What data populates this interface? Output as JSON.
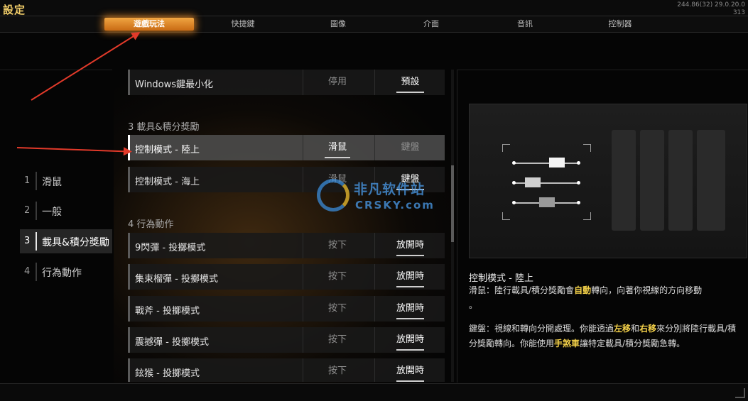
{
  "window": {
    "title": "設定",
    "version_line1": "244.86(32) 29.0.20.0",
    "version_line2": "313"
  },
  "tabs": [
    {
      "label": "遊戲玩法",
      "active": true
    },
    {
      "label": "快捷鍵",
      "active": false
    },
    {
      "label": "圖像",
      "active": false
    },
    {
      "label": "介面",
      "active": false
    },
    {
      "label": "音訊",
      "active": false
    },
    {
      "label": "控制器",
      "active": false
    }
  ],
  "categories": [
    {
      "num": "1",
      "label": "滑鼠",
      "active": false
    },
    {
      "num": "2",
      "label": "一般",
      "active": false
    },
    {
      "num": "3",
      "label": "載具&積分獎勵",
      "active": true
    },
    {
      "num": "4",
      "label": "行為動作",
      "active": false
    }
  ],
  "settings": {
    "top_row": {
      "name": "Windows鍵最小化",
      "opt1": "停用",
      "opt2": "預設",
      "selected": "opt2"
    },
    "section3": "3 載具&積分獎勵",
    "vehicle_rows": [
      {
        "name": "控制模式 - 陸上",
        "opt1": "滑鼠",
        "opt2": "鍵盤",
        "selected": "opt1",
        "highlighted": true
      },
      {
        "name": "控制模式 - 海上",
        "opt1": "滑鼠",
        "opt2": "鍵盤",
        "selected": "opt2",
        "highlighted": false
      }
    ],
    "section4": "4 行為動作",
    "action_rows": [
      {
        "name": "9閃彈 - 投擲模式",
        "opt1": "按下",
        "opt2": "放開時",
        "selected": "opt2"
      },
      {
        "name": "集束榴彈 - 投擲模式",
        "opt1": "按下",
        "opt2": "放開時",
        "selected": "opt2"
      },
      {
        "name": "戰斧 - 投擲模式",
        "opt1": "按下",
        "opt2": "放開時",
        "selected": "opt2"
      },
      {
        "name": "震撼彈 - 投擲模式",
        "opt1": "按下",
        "opt2": "放開時",
        "selected": "opt2"
      },
      {
        "name": "鉉猴 - 投擲模式",
        "opt1": "按下",
        "opt2": "放開時",
        "selected": "opt2"
      }
    ]
  },
  "watermark": {
    "line1": "非凡软件站",
    "line2": "CRSKY.com"
  },
  "description": {
    "title": "控制模式 - 陸上",
    "mouse_label": "滑鼠：",
    "mouse_text_a": "陸行載具/積分獎勵會",
    "mouse_hl": "自動",
    "mouse_text_b": "轉向，向著你視線的方向移動",
    "mouse_end": "。",
    "kb_label": "鍵盤：",
    "kb_text_a": "視線和轉向分開處理。你能透過",
    "kb_hl1": "左移",
    "kb_text_b": "和",
    "kb_hl2": "右移",
    "kb_text_c": "來分別將陸行載具/積分獎勵轉向。你能使用",
    "kb_hl3": "手煞車",
    "kb_text_d": "讓特定載具/積分獎勵急轉。"
  },
  "colors": {
    "accent_tab": "#e8903a",
    "highlight_text": "#f5d24a",
    "annotation_arrow": "#e23a2a"
  }
}
